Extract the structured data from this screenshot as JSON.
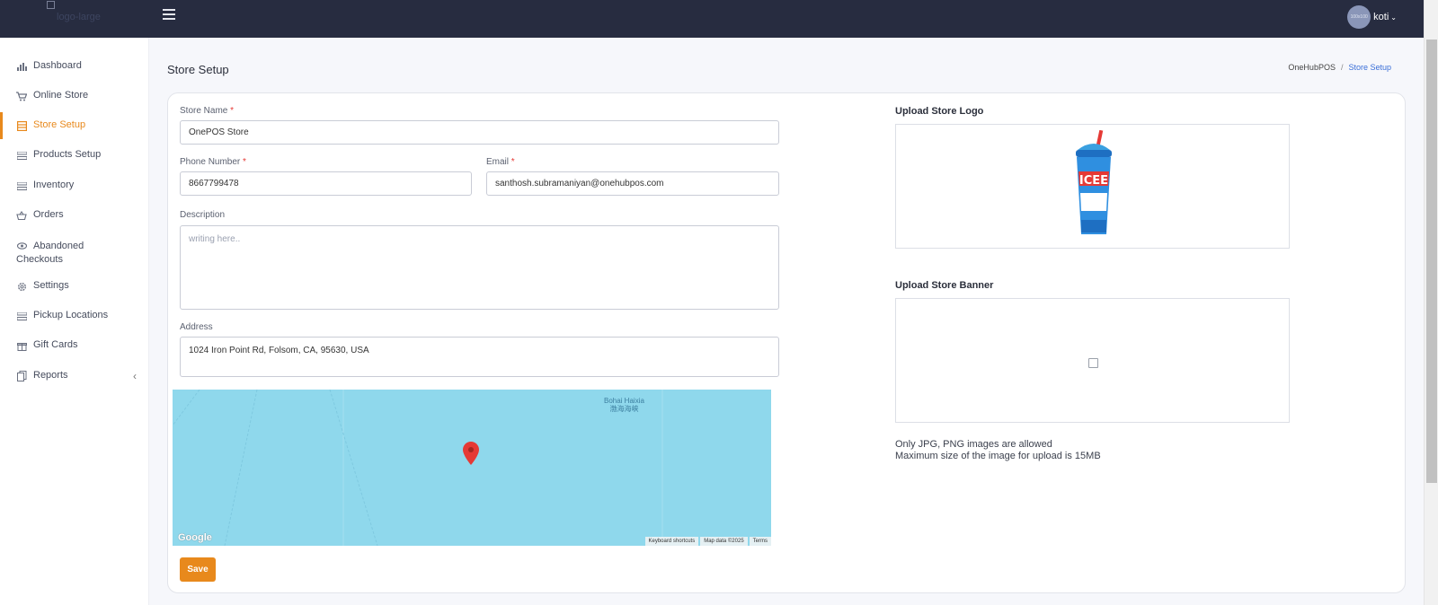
{
  "header": {
    "logo_alt": "logo-large",
    "user": {
      "avatar_text": "100x100",
      "name": "koti"
    }
  },
  "sidebar": {
    "items": [
      {
        "label": "Dashboard",
        "icon": "chart-bar-icon"
      },
      {
        "label": "Online Store",
        "icon": "cart-icon"
      },
      {
        "label": "Store Setup",
        "icon": "store-icon",
        "active": true
      },
      {
        "label": "Products Setup",
        "icon": "list-icon"
      },
      {
        "label": "Inventory",
        "icon": "list-icon"
      },
      {
        "label": "Orders",
        "icon": "basket-icon"
      },
      {
        "label": "Abandoned Checkouts",
        "label_line1": "Abandoned",
        "label_line2": "Checkouts",
        "icon": "eye-icon"
      },
      {
        "label": "Settings",
        "icon": "gear-icon"
      },
      {
        "label": "Pickup Locations",
        "icon": "list-icon"
      },
      {
        "label": "Gift Cards",
        "icon": "gift-icon"
      },
      {
        "label": "Reports",
        "icon": "reports-icon",
        "expand_icon": "chevron-left-icon"
      }
    ]
  },
  "page": {
    "title": "Store Setup",
    "breadcrumb": {
      "root": "OneHubPOS",
      "separator": "/",
      "current": "Store Setup"
    }
  },
  "form": {
    "store_name": {
      "label": "Store Name",
      "required_mark": "*",
      "value": "OnePOS Store"
    },
    "phone": {
      "label": "Phone Number",
      "required_mark": "*",
      "value": "8667799478"
    },
    "email": {
      "label": "Email",
      "required_mark": "*",
      "value": "santhosh.subramaniyan@onehubpos.com"
    },
    "description": {
      "label": "Description",
      "placeholder": "writing here..",
      "value": ""
    },
    "address": {
      "label": "Address",
      "value": "1024 Iron Point Rd, Folsom, CA, 95630, USA"
    },
    "save_label": "Save"
  },
  "map": {
    "sea_label_en": "Bohai Haixia",
    "sea_label_cn": "渤海海峡",
    "google_label": "Google",
    "attribution": [
      "Keyboard shortcuts",
      "Map data ©2025",
      "Terms"
    ]
  },
  "uploads": {
    "logo_title": "Upload Store Logo",
    "logo_image_text": "ICEE",
    "banner_title": "Upload Store Banner",
    "note_line1": "Only JPG, PNG images are allowed",
    "note_line2": "Maximum size of the image for upload is 15MB"
  },
  "colors": {
    "accent": "#e8891c",
    "topbar": "#272c40",
    "link": "#3b6fd8",
    "map_water": "#8fd8ec"
  }
}
